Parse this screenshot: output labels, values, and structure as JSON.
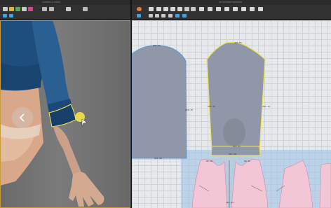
{
  "window": {
    "left_title": "CAMERA & WORK",
    "right_title": "2D PATTERN WINDOW"
  },
  "pattern_labels": {
    "back_sleeve_top": "245.65",
    "back_sleeve_side": "243.15",
    "back_sleeve_bottom": "221.58",
    "front_sleeve_top": "245.65",
    "front_sleeve_left": "243.15",
    "front_sleeve_right": "243.15",
    "cuff": "214.22",
    "sleeve_bottom": "221.58",
    "bodice_1": "83.58",
    "bodice_2": "60.18",
    "bodice_3": "166.44"
  },
  "colors": {
    "accent": "#c89a3a",
    "selection": "#f2e44a",
    "sleeve_piece": "#8f97a8",
    "bodice_piece": "#f3c6d6",
    "jacket": "#1e4e7c"
  },
  "icons": {
    "left_toolbar": [
      "select-icon",
      "move-icon",
      "garment-icon",
      "avatar-icon",
      "camera-icon",
      "zoom-icon",
      "grid-icon",
      "view-icon",
      "texture-icon"
    ],
    "right_toolbar": [
      "transform-icon",
      "edit-point-icon",
      "curve-icon",
      "polygon-icon",
      "rectangle-icon",
      "circle-icon",
      "dart-icon",
      "sewing-icon",
      "seam-icon",
      "pin-icon",
      "fold-icon",
      "measure-icon",
      "notch-icon",
      "symmetry-icon",
      "layout-icon",
      "arrange-icon"
    ]
  }
}
